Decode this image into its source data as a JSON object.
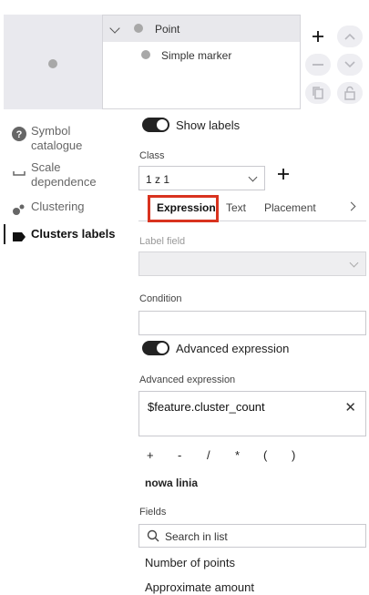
{
  "tree": {
    "parent_label": "Point",
    "child_label": "Simple marker"
  },
  "nav": {
    "items": [
      {
        "label": "Symbol catalogue",
        "icon": "help-circle-icon"
      },
      {
        "label": "Scale dependence",
        "icon": "scale-icon"
      },
      {
        "label": "Clustering",
        "icon": "clustering-icon"
      },
      {
        "label": "Clusters labels",
        "icon": "label-tag-icon",
        "active": true
      }
    ]
  },
  "show_labels": {
    "label": "Show labels",
    "on": true
  },
  "class_field": {
    "label": "Class",
    "value": "1 z 1"
  },
  "tabs": [
    "Expression",
    "Text",
    "Placement"
  ],
  "active_tab": "Expression",
  "label_field": {
    "label": "Label field",
    "value": "",
    "disabled": true
  },
  "condition": {
    "label": "Condition",
    "value": ""
  },
  "advanced_toggle": {
    "label": "Advanced expression",
    "on": true
  },
  "advanced_expression": {
    "label": "Advanced expression",
    "value": "$feature.cluster_count"
  },
  "operators": [
    "+",
    "-",
    "/",
    "*",
    "(",
    ")"
  ],
  "new_line": "nowa linia",
  "fields": {
    "label": "Fields",
    "search_placeholder": "Search in list",
    "items": [
      "Number of points",
      "Approximate amount"
    ]
  },
  "colors": {
    "highlight": "#d9331f",
    "toggle_on": "#222222"
  }
}
